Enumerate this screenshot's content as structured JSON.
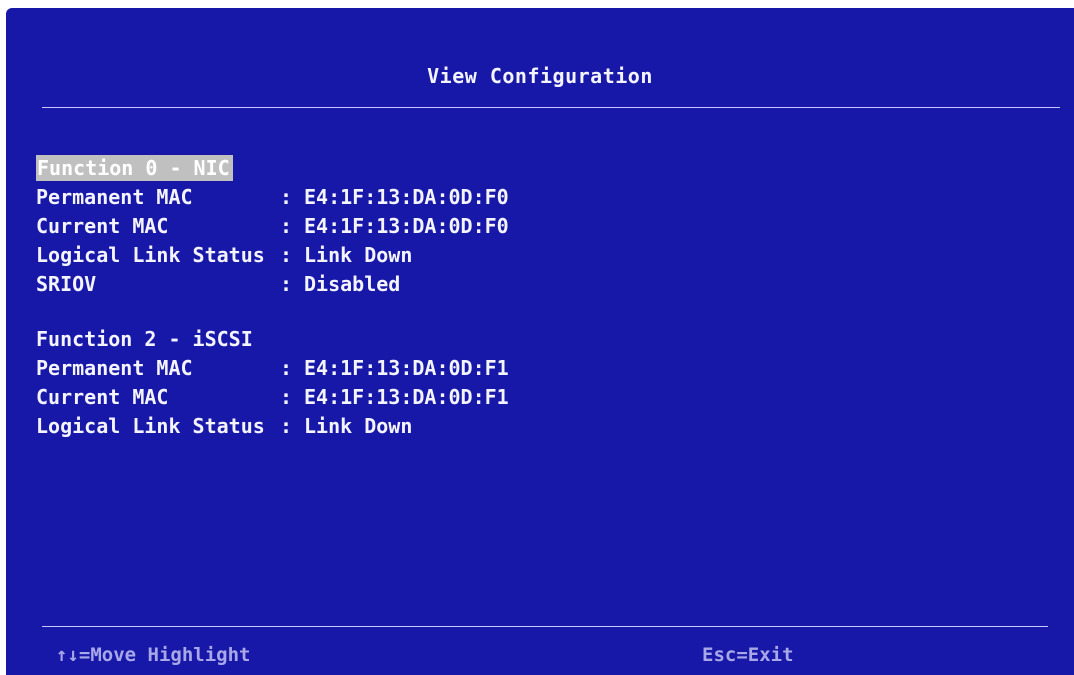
{
  "header": {
    "title": "View Configuration"
  },
  "functions": [
    {
      "heading": "Function 0 - NIC",
      "rows": [
        {
          "label": "Permanent MAC",
          "sep": ":",
          "value": "E4:1F:13:DA:0D:F0"
        },
        {
          "label": "Current MAC",
          "sep": ":",
          "value": "E4:1F:13:DA:0D:F0"
        },
        {
          "label": "Logical Link Status",
          "sep": ":",
          "value": "Link Down"
        },
        {
          "label": "SRIOV",
          "sep": ":",
          "value": "Disabled"
        }
      ]
    },
    {
      "heading": "Function 2 - iSCSI",
      "rows": [
        {
          "label": "Permanent MAC",
          "sep": ":",
          "value": "E4:1F:13:DA:0D:F1"
        },
        {
          "label": "Current MAC",
          "sep": ":",
          "value": "E4:1F:13:DA:0D:F1"
        },
        {
          "label": "Logical Link Status",
          "sep": ":",
          "value": "Link Down"
        }
      ]
    }
  ],
  "footer": {
    "move_hint": "↑↓=Move Highlight",
    "exit_hint": "Esc=Exit"
  },
  "colors": {
    "background": "#1818a8",
    "text": "#f4f4ff",
    "highlight": "#c0c0c0",
    "footer_text": "#a8a8e8"
  }
}
